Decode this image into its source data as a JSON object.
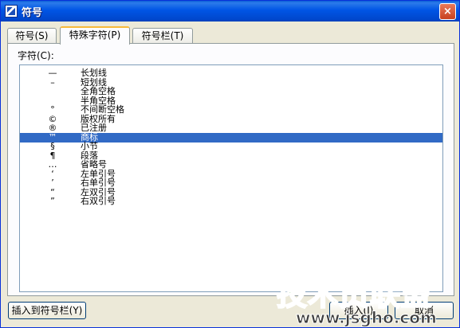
{
  "window": {
    "title": "符号",
    "close_glyph": "×"
  },
  "tabs": [
    {
      "label": "符号(S)",
      "active": false
    },
    {
      "label": "特殊字符(P)",
      "active": true
    },
    {
      "label": "符号栏(T)",
      "active": false
    }
  ],
  "panel": {
    "chars_label": "字符(C):"
  },
  "characters": [
    {
      "symbol": "—",
      "name": "长划线",
      "selected": false
    },
    {
      "symbol": "–",
      "name": "短划线",
      "selected": false
    },
    {
      "symbol": "",
      "name": "全角空格",
      "selected": false
    },
    {
      "symbol": "",
      "name": "半角空格",
      "selected": false
    },
    {
      "symbol": "°",
      "name": "不间断空格",
      "selected": false
    },
    {
      "symbol": "©",
      "name": "版权所有",
      "selected": false
    },
    {
      "symbol": "®",
      "name": "已注册",
      "selected": false
    },
    {
      "symbol": "™",
      "name": "商标",
      "selected": true
    },
    {
      "symbol": "§",
      "name": "小节",
      "selected": false
    },
    {
      "symbol": "¶",
      "name": "段落",
      "selected": false
    },
    {
      "symbol": "…",
      "name": "省略号",
      "selected": false
    },
    {
      "symbol": "‘",
      "name": "左单引号",
      "selected": false
    },
    {
      "symbol": "’",
      "name": "右单引号",
      "selected": false
    },
    {
      "symbol": "“",
      "name": "左双引号",
      "selected": false
    },
    {
      "symbol": "”",
      "name": "右双引号",
      "selected": false
    }
  ],
  "buttons": {
    "add_to_toolbar": "插入到符号栏(Y)",
    "insert": "插入(I)",
    "cancel": "取消"
  },
  "watermark": {
    "main": "技术员联盟",
    "url": "www.jsgho.com"
  },
  "colors": {
    "selection": "#316ac5",
    "titlebar": "#0055e5",
    "watermark": "#45b83a"
  }
}
